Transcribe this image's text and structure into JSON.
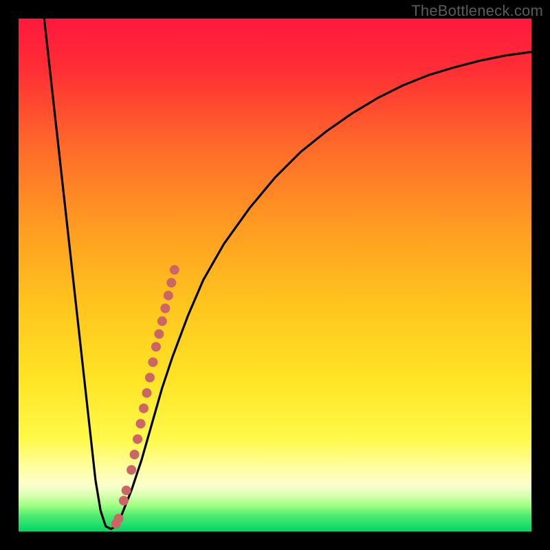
{
  "watermark": "TheBottleneck.com",
  "colors": {
    "frame": "#000000",
    "gradient_top": "#ff1a3a",
    "gradient_mid_upper": "#ff5a2a",
    "gradient_mid": "#ffb020",
    "gradient_mid_lower": "#ffe528",
    "gradient_yellow_band": "#ffff66",
    "gradient_green_top": "#8cff5a",
    "gradient_green": "#00e676",
    "curve": "#000000",
    "dots": "#cc6666"
  },
  "chart_data": {
    "type": "line",
    "title": "",
    "xlabel": "",
    "ylabel": "",
    "xlim": [
      0,
      100
    ],
    "ylim": [
      0,
      100
    ],
    "series": [
      {
        "name": "bottleneck-curve",
        "x": [
          5,
          6,
          7,
          8,
          9,
          10,
          11,
          12,
          13,
          14,
          15,
          16,
          17,
          18,
          19,
          20,
          22,
          24,
          26,
          28,
          30,
          33,
          36,
          40,
          45,
          50,
          55,
          60,
          65,
          70,
          75,
          80,
          85,
          90,
          95,
          100
        ],
        "values": [
          100,
          91,
          82,
          73,
          64,
          55,
          46,
          37,
          28,
          19,
          10,
          4,
          1,
          0.5,
          1,
          3,
          8,
          14,
          21,
          28,
          34,
          42,
          49,
          56,
          63,
          69,
          74,
          78,
          81.5,
          84.5,
          87,
          89,
          90.5,
          91.8,
          92.8,
          93.5
        ]
      }
    ],
    "highlight_points": {
      "name": "data-dots",
      "x": [
        19.0,
        19.5,
        20.5,
        21.0,
        22.0,
        22.6,
        23.2,
        23.8,
        24.4,
        25.0,
        25.6,
        26.2,
        26.8,
        27.4,
        28.0,
        28.6,
        29.2,
        29.8,
        30.4
      ],
      "values": [
        1.5,
        2.5,
        6,
        8,
        12,
        15,
        18,
        21,
        24,
        27,
        30,
        33,
        36,
        38.5,
        41,
        43.5,
        46,
        48.5,
        51
      ]
    }
  }
}
